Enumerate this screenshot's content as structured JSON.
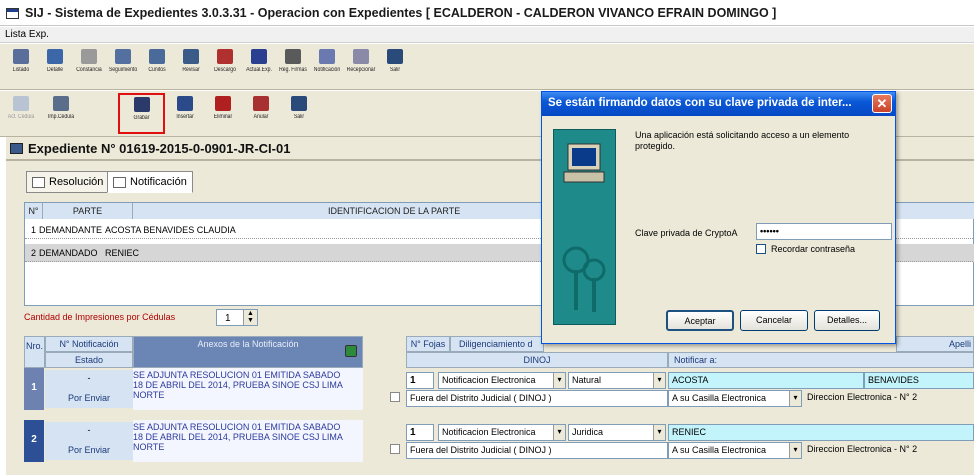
{
  "window": {
    "title": "SIJ - Sistema de Expedientes 3.0.3.31 - Operacion con Expedientes  [ ECALDERON - CALDERON VIVANCO EFRAIN DOMINGO ]"
  },
  "menu": {
    "item": "Lista Exp."
  },
  "toolbar1": [
    {
      "label": "Listado",
      "icon": "list-icon",
      "color": "#5a6e9c"
    },
    {
      "label": "Detalle",
      "icon": "detail-icon",
      "color": "#3b66a8"
    },
    {
      "label": "Constancia",
      "icon": "book-icon",
      "color": "#9a9a9a"
    },
    {
      "label": "Seguimiento",
      "icon": "tracking-icon",
      "color": "#5470a0"
    },
    {
      "label": "Cuñitos",
      "icon": "stamp-icon",
      "color": "#4a6a9a"
    },
    {
      "label": "Revisar",
      "icon": "review-icon",
      "color": "#3a5a88"
    },
    {
      "label": "Descargo",
      "icon": "discharge-icon",
      "color": "#b03030"
    },
    {
      "label": "Actual.Exp.",
      "icon": "update-icon",
      "color": "#2a3f90"
    },
    {
      "label": "Reg. Firmas",
      "icon": "signature-icon",
      "color": "#5a5a5a"
    },
    {
      "label": "Notificación",
      "icon": "notification-icon",
      "color": "#6a7ab0"
    },
    {
      "label": "Recepcionar",
      "icon": "receive-icon",
      "color": "#8a8aa8"
    },
    {
      "label": "Salir",
      "icon": "exit-icon",
      "color": "#2a4a7a"
    }
  ],
  "toolbar2": [
    {
      "label": "Act. Cédula",
      "icon": "refresh-icon",
      "color": "#b8c4d4",
      "disabled": true
    },
    {
      "label": "Imp.Cédula",
      "icon": "print-icon",
      "color": "#5a6e8c"
    },
    {
      "label": "Grabar",
      "icon": "save-icon",
      "color": "#2a3a6a",
      "highlight": true
    },
    {
      "label": "Insertar",
      "icon": "insert-icon",
      "color": "#2a4a8a"
    },
    {
      "label": "Eliminar",
      "icon": "delete-icon",
      "color": "#b02020"
    },
    {
      "label": "Anular",
      "icon": "cancel-icon",
      "color": "#a83030"
    },
    {
      "label": "Salir",
      "icon": "exit-icon",
      "color": "#2a4a7a"
    }
  ],
  "expediente": {
    "title": "Expediente N° 01619-2015-0-0901-JR-CI-01"
  },
  "tabs": [
    {
      "label": "Resolución",
      "icon": "resolution-icon"
    },
    {
      "label": "Notificación",
      "icon": "notification-icon"
    }
  ],
  "partes": {
    "headers": [
      "N°",
      "PARTE",
      "IDENTIFICACION DE LA PARTE"
    ],
    "rows": [
      {
        "n": "1",
        "parte": "DEMANDANTE",
        "nombre": "ACOSTA BENAVIDES CLAUDIA"
      },
      {
        "n": "2",
        "parte": "DEMANDADO",
        "nombre": "RENIEC"
      }
    ]
  },
  "impresiones": {
    "label": "Cantidad de Impresiones por Cédulas",
    "value": "1"
  },
  "notif_table": {
    "h_nro": "Nro.",
    "h_nnotif": "N° Notificación",
    "h_estado": "Estado",
    "h_anexos": "Anexos de la Notificación",
    "h_fojas": "N° Fojas",
    "h_dilig": "Diligenciamiento d",
    "h_dinoj": "DINOJ",
    "h_notificar": "Notificar a:",
    "h_apell": "Apelli",
    "rows": [
      {
        "nro": "1",
        "nnotif": "-",
        "estado": "Por Enviar",
        "anexo1": "SE ADJUNTA RESOLUCION 01 EMITIDA SABADO",
        "anexo2": "18 DE ABRIL DEL 2014, PRUEBA SINOE CSJ LIMA",
        "anexo3": "NORTE",
        "fojas": "1",
        "tipo": "Notificacion Electronica",
        "persona": "Natural",
        "nombre": "ACOSTA",
        "apellido": "BENAVIDES",
        "fuera": "Fuera del Distrito Judicial ( DINOJ )",
        "casilla": "A su Casilla Electronica",
        "direccion": "Direccion Electronica - N° 2"
      },
      {
        "nro": "2",
        "nnotif": "-",
        "estado": "Por Enviar",
        "anexo1": "SE ADJUNTA RESOLUCION 01 EMITIDA SABADO",
        "anexo2": "18 DE ABRIL DEL 2014, PRUEBA SINOE CSJ LIMA",
        "anexo3": "NORTE",
        "fojas": "1",
        "tipo": "Notificacion Electronica",
        "persona": "Juridica",
        "nombre": "RENIEC",
        "apellido": "",
        "fuera": "Fuera del Distrito Judicial ( DINOJ )",
        "casilla": "A su Casilla Electronica",
        "direccion": "Direccion Electronica - N° 2"
      }
    ]
  },
  "dialog": {
    "title": "Se están firmando datos con su clave privada de inter...",
    "message": "Una aplicación está solicitando acceso a un elemento protegido.",
    "key_label": "Clave privada de CryptoA",
    "password": "••••••",
    "remember": "Recordar contraseña",
    "ok": "Aceptar",
    "cancel": "Cancelar",
    "details": "Detalles..."
  }
}
